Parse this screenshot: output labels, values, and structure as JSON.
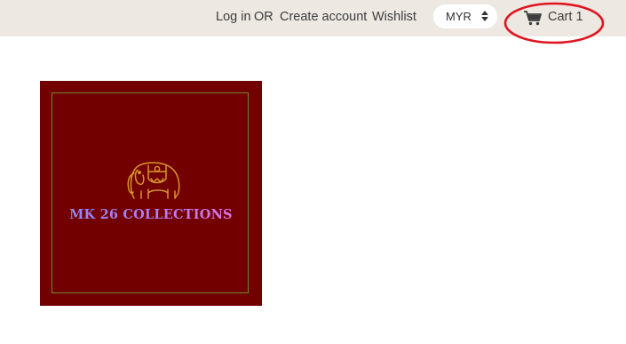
{
  "header": {
    "login_label": "Log in",
    "or_label": "OR",
    "create_account_label": "Create account",
    "wishlist_label": "Wishlist",
    "currency": {
      "selected": "MYR",
      "icon": "sort-arrows-icon"
    },
    "cart": {
      "label": "Cart",
      "count": "1",
      "icon": "cart-icon"
    }
  },
  "logo": {
    "text": "MK 26 COLLECTIONS",
    "icon": "elephant-icon",
    "background_color": "#730000",
    "border_color": "#6e8c2c"
  },
  "colors": {
    "topbar_background": "#ede8e2",
    "annotation_ellipse": "#e0141e"
  }
}
